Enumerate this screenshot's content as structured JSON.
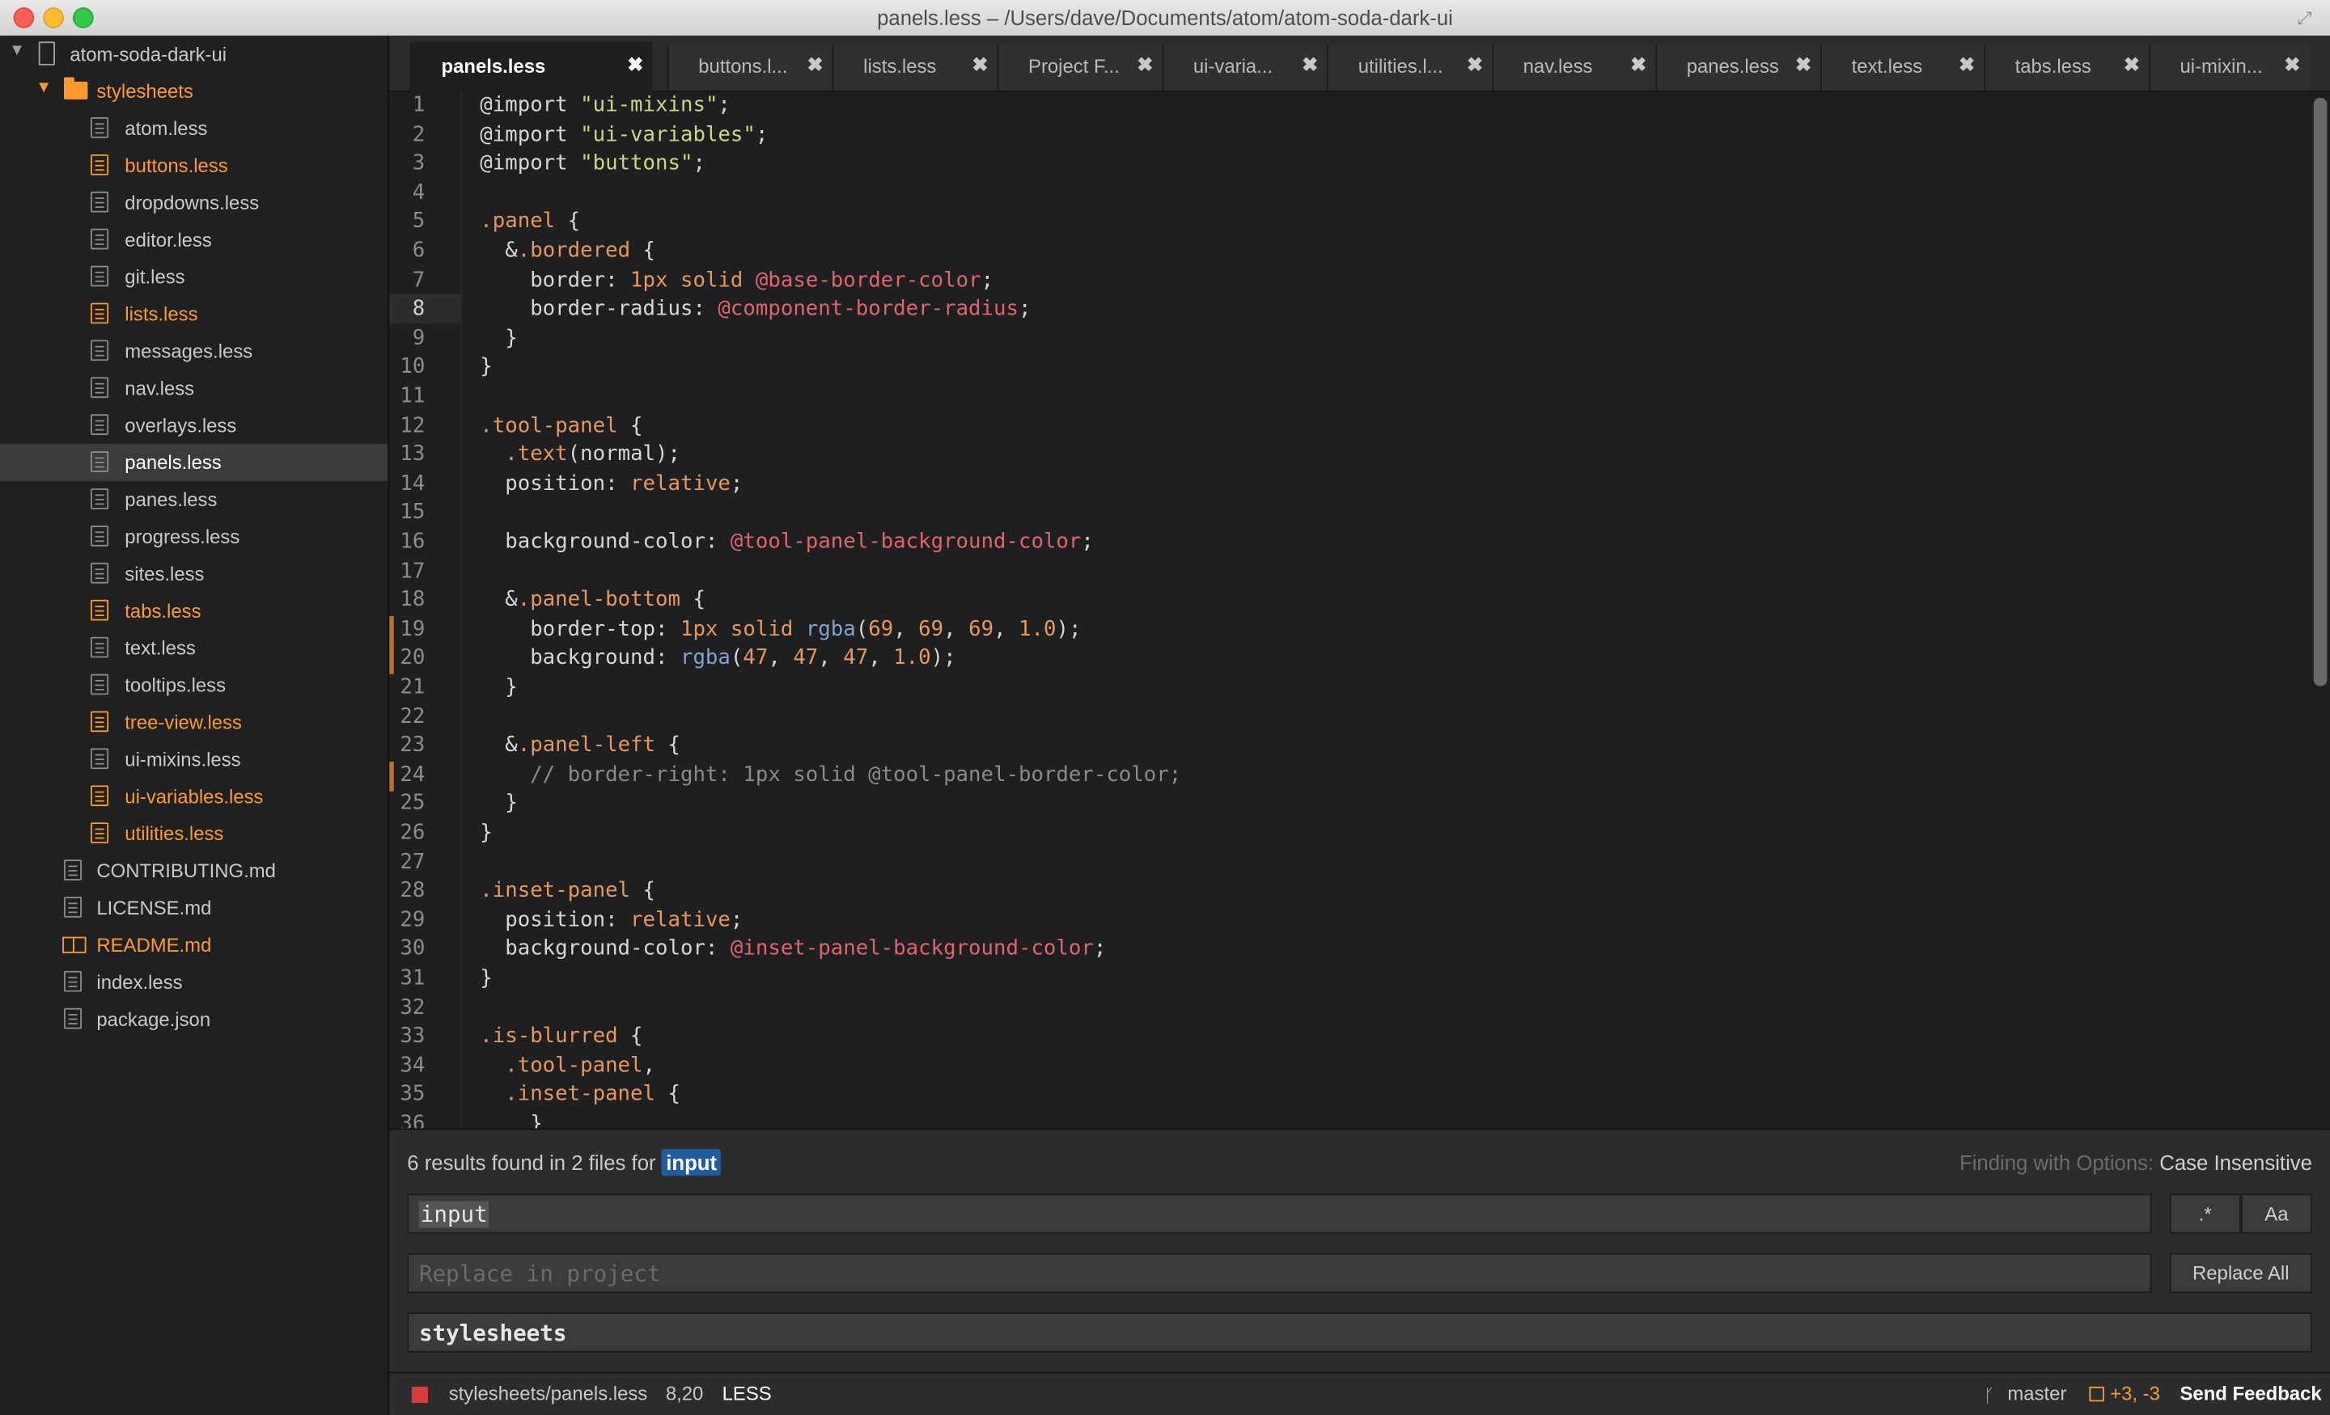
{
  "window": {
    "title": "panels.less – /Users/dave/Documents/atom/atom-soda-dark-ui"
  },
  "colors": {
    "modified": "#fd9a2b",
    "accent": "#1f5d9e",
    "error": "#d73a3a"
  },
  "sidebar": {
    "root": "atom-soda-dark-ui",
    "folder": "stylesheets",
    "files": [
      {
        "name": "atom.less",
        "modified": false
      },
      {
        "name": "buttons.less",
        "modified": true
      },
      {
        "name": "dropdowns.less",
        "modified": false
      },
      {
        "name": "editor.less",
        "modified": false
      },
      {
        "name": "git.less",
        "modified": false
      },
      {
        "name": "lists.less",
        "modified": true
      },
      {
        "name": "messages.less",
        "modified": false
      },
      {
        "name": "nav.less",
        "modified": false
      },
      {
        "name": "overlays.less",
        "modified": false
      },
      {
        "name": "panels.less",
        "modified": false,
        "selected": true
      },
      {
        "name": "panes.less",
        "modified": false
      },
      {
        "name": "progress.less",
        "modified": false
      },
      {
        "name": "sites.less",
        "modified": false
      },
      {
        "name": "tabs.less",
        "modified": true
      },
      {
        "name": "text.less",
        "modified": false
      },
      {
        "name": "tooltips.less",
        "modified": false
      },
      {
        "name": "tree-view.less",
        "modified": true
      },
      {
        "name": "ui-mixins.less",
        "modified": false
      },
      {
        "name": "ui-variables.less",
        "modified": true
      },
      {
        "name": "utilities.less",
        "modified": true
      }
    ],
    "root_files": [
      {
        "name": "CONTRIBUTING.md",
        "modified": false,
        "icon": "file-icon"
      },
      {
        "name": "LICENSE.md",
        "modified": false,
        "icon": "file-icon"
      },
      {
        "name": "README.md",
        "modified": true,
        "icon": "book-icon"
      },
      {
        "name": "index.less",
        "modified": false,
        "icon": "file-icon"
      },
      {
        "name": "package.json",
        "modified": false,
        "icon": "file-icon"
      }
    ]
  },
  "tabs": [
    {
      "label": "panels.less",
      "active": true
    },
    {
      "label": "buttons.l..."
    },
    {
      "label": "lists.less"
    },
    {
      "label": "Project F..."
    },
    {
      "label": "ui-varia..."
    },
    {
      "label": "utilities.l..."
    },
    {
      "label": "nav.less"
    },
    {
      "label": "panes.less"
    },
    {
      "label": "text.less"
    },
    {
      "label": "tabs.less"
    },
    {
      "label": "ui-mixin..."
    }
  ],
  "editor": {
    "current_line": 8,
    "modified_lines": [
      19,
      20,
      24
    ],
    "lines": [
      [
        [
          "@import ",
          "kw"
        ],
        [
          "\"ui-mixins\"",
          "str"
        ],
        [
          ";",
          "kw"
        ]
      ],
      [
        [
          "@import ",
          "kw"
        ],
        [
          "\"ui-variables\"",
          "str"
        ],
        [
          ";",
          "kw"
        ]
      ],
      [
        [
          "@import ",
          "kw"
        ],
        [
          "\"buttons\"",
          "str"
        ],
        [
          ";",
          "kw"
        ]
      ],
      [],
      [
        [
          ".panel",
          "sel"
        ],
        [
          " {",
          "kw"
        ]
      ],
      [
        [
          "  &",
          "kw"
        ],
        [
          ".bordered",
          "sel"
        ],
        [
          " {",
          "kw"
        ]
      ],
      [
        [
          "    border: ",
          "kw"
        ],
        [
          "1px",
          "num"
        ],
        [
          " solid ",
          "sel"
        ],
        [
          "@base-border-color",
          "var"
        ],
        [
          ";",
          "kw"
        ]
      ],
      [
        [
          "    border-radius: ",
          "kw"
        ],
        [
          "@component-border-radius",
          "var"
        ],
        [
          ";",
          "kw"
        ]
      ],
      [
        [
          "  }",
          "kw"
        ]
      ],
      [
        [
          "}",
          "kw"
        ]
      ],
      [],
      [
        [
          ".tool-panel",
          "sel"
        ],
        [
          " {",
          "kw"
        ]
      ],
      [
        [
          "  .text",
          "sel"
        ],
        [
          "(normal);",
          "kw"
        ]
      ],
      [
        [
          "  position: ",
          "kw"
        ],
        [
          "relative",
          "sel"
        ],
        [
          ";",
          "kw"
        ]
      ],
      [],
      [
        [
          "  background-color: ",
          "kw"
        ],
        [
          "@tool-panel-background-color",
          "var"
        ],
        [
          ";",
          "kw"
        ]
      ],
      [],
      [
        [
          "  &",
          "kw"
        ],
        [
          ".panel-bottom",
          "sel"
        ],
        [
          " {",
          "kw"
        ]
      ],
      [
        [
          "    border-top: ",
          "kw"
        ],
        [
          "1px",
          "num"
        ],
        [
          " solid ",
          "sel"
        ],
        [
          "rgba",
          "fn"
        ],
        [
          "(",
          "kw"
        ],
        [
          "69",
          "num"
        ],
        [
          ", ",
          "kw"
        ],
        [
          "69",
          "num"
        ],
        [
          ", ",
          "kw"
        ],
        [
          "69",
          "num"
        ],
        [
          ", ",
          "kw"
        ],
        [
          "1.0",
          "num"
        ],
        [
          ");",
          "kw"
        ]
      ],
      [
        [
          "    background: ",
          "kw"
        ],
        [
          "rgba",
          "fn"
        ],
        [
          "(",
          "kw"
        ],
        [
          "47",
          "num"
        ],
        [
          ", ",
          "kw"
        ],
        [
          "47",
          "num"
        ],
        [
          ", ",
          "kw"
        ],
        [
          "47",
          "num"
        ],
        [
          ", ",
          "kw"
        ],
        [
          "1.0",
          "num"
        ],
        [
          ");",
          "kw"
        ]
      ],
      [
        [
          "  }",
          "kw"
        ]
      ],
      [],
      [
        [
          "  &",
          "kw"
        ],
        [
          ".panel-left",
          "sel"
        ],
        [
          " {",
          "kw"
        ]
      ],
      [
        [
          "    // border-right: 1px solid @tool-panel-border-color;",
          "cm"
        ]
      ],
      [
        [
          "  }",
          "kw"
        ]
      ],
      [
        [
          "}",
          "kw"
        ]
      ],
      [],
      [
        [
          ".inset-panel",
          "sel"
        ],
        [
          " {",
          "kw"
        ]
      ],
      [
        [
          "  position: ",
          "kw"
        ],
        [
          "relative",
          "sel"
        ],
        [
          ";",
          "kw"
        ]
      ],
      [
        [
          "  background-color: ",
          "kw"
        ],
        [
          "@inset-panel-background-color",
          "var"
        ],
        [
          ";",
          "kw"
        ]
      ],
      [
        [
          "}",
          "kw"
        ]
      ],
      [],
      [
        [
          ".is-blurred",
          "sel"
        ],
        [
          " {",
          "kw"
        ]
      ],
      [
        [
          "  .tool-panel",
          "sel"
        ],
        [
          ",",
          "kw"
        ]
      ],
      [
        [
          "  .inset-panel",
          "sel"
        ],
        [
          " {",
          "kw"
        ]
      ],
      [
        [
          "    }",
          "kw"
        ]
      ]
    ]
  },
  "find": {
    "results_text": "6 results found in 2 files for",
    "term": "input",
    "options_label": "Finding with Options:",
    "options_value": "Case Insensitive",
    "search_value": "input",
    "replace_placeholder": "Replace in project",
    "paths_value": "stylesheets",
    "regex_label": ".*",
    "case_label": "Aa",
    "replace_all_label": "Replace All"
  },
  "status": {
    "path": "stylesheets/panels.less",
    "cursor": "8,20",
    "grammar": "LESS",
    "branch": "master",
    "diff": "+3, -3",
    "feedback": "Send Feedback"
  }
}
